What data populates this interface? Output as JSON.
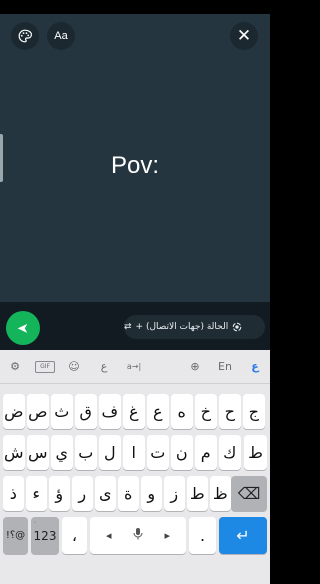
{
  "composer": {
    "status_text": "Pov:",
    "font_button_label": "Aa",
    "close_glyph": "✕"
  },
  "audience": {
    "label": "الحالة (جهات الاتصال) +",
    "icon": "status-icon",
    "swap_icon": "⇄"
  },
  "send": {
    "glyph": "➤"
  },
  "keyboard": {
    "toolbar": [
      {
        "name": "settings-icon",
        "label": "⚙"
      },
      {
        "name": "gif-button",
        "label": "GIF"
      },
      {
        "name": "emoji-icon",
        "label": "☺"
      },
      {
        "name": "handwriting-icon",
        "label": "ع"
      },
      {
        "name": "translate-icon",
        "label": "a→|"
      },
      {
        "name": "globe-icon",
        "label": "⊕"
      },
      {
        "name": "lang-en-button",
        "label": "En"
      },
      {
        "name": "lang-ar-button",
        "label": "ع"
      }
    ],
    "row1": [
      {
        "label": "ج",
        "hint": ""
      },
      {
        "label": "ح",
        "hint": ""
      },
      {
        "label": "خ",
        "hint": ""
      },
      {
        "label": "ه",
        "hint": ""
      },
      {
        "label": "ع",
        "hint": ""
      },
      {
        "label": "غ",
        "hint": ""
      },
      {
        "label": "ف",
        "hint": ""
      },
      {
        "label": "ق",
        "hint": ""
      },
      {
        "label": "ث",
        "hint": ""
      },
      {
        "label": "ص",
        "hint": ""
      },
      {
        "label": "ض",
        "hint": ""
      }
    ],
    "row2": [
      {
        "label": "ك",
        "hint": ""
      },
      {
        "label": "م",
        "hint": ""
      },
      {
        "label": "ن",
        "hint": ""
      },
      {
        "label": "ت",
        "hint": ""
      },
      {
        "label": "ا",
        "hint": ""
      },
      {
        "label": "ل",
        "hint": ""
      },
      {
        "label": "ب",
        "hint": ""
      },
      {
        "label": "ي",
        "hint": ""
      },
      {
        "label": "س",
        "hint": ""
      },
      {
        "label": "ش",
        "hint": ""
      }
    ],
    "row2_extra": {
      "label": "ط"
    },
    "row3": [
      {
        "label": "ظ",
        "hint": ""
      },
      {
        "label": "ط",
        "hint": ""
      },
      {
        "label": "ز",
        "hint": ""
      },
      {
        "label": "و",
        "hint": ""
      },
      {
        "label": "ة",
        "hint": ""
      },
      {
        "label": "ى",
        "hint": ""
      },
      {
        "label": "ر",
        "hint": ""
      },
      {
        "label": "ؤ",
        "hint": ""
      },
      {
        "label": "ء",
        "hint": ""
      },
      {
        "label": "ذ",
        "hint": ""
      }
    ],
    "backspace": "⌫",
    "symbols_label": "!؟@",
    "numbers_label": "123",
    "comma": "،",
    "space_left": "◂",
    "space_right": "▸",
    "mic_glyph": "🎙",
    "period": ".",
    "enter_glyph": "↵"
  },
  "colors": {
    "composer_bg": "#253540",
    "send_green": "#14b45a",
    "enter_blue": "#1e88e5"
  }
}
